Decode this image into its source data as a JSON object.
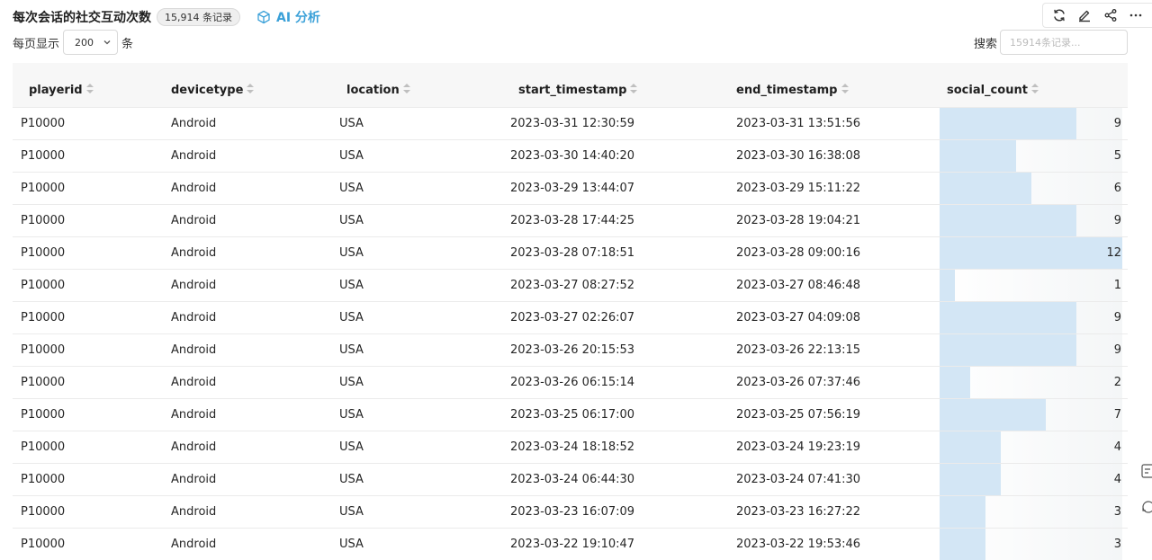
{
  "header": {
    "title": "每次会话的社交互动次数",
    "record_badge": "15,914 条记录",
    "ai_label": "AI 分析"
  },
  "toolbar": {
    "icons": [
      "refresh-icon",
      "edit-icon",
      "share-icon",
      "more-icon"
    ]
  },
  "pagination": {
    "prefix": "每页显示",
    "page_size": "200",
    "suffix": "条"
  },
  "search": {
    "label": "搜索",
    "placeholder": "15914条记录..."
  },
  "table": {
    "columns": [
      "playerid",
      "devicetype",
      "location",
      "start_timestamp",
      "end_timestamp",
      "social_count"
    ],
    "bar_max": 12,
    "bar_color": "#d3e6f5",
    "rows": [
      [
        "P10000",
        "Android",
        "USA",
        "2023-03-31 12:30:59",
        "2023-03-31 13:51:56",
        "9"
      ],
      [
        "P10000",
        "Android",
        "USA",
        "2023-03-30 14:40:20",
        "2023-03-30 16:38:08",
        "5"
      ],
      [
        "P10000",
        "Android",
        "USA",
        "2023-03-29 13:44:07",
        "2023-03-29 15:11:22",
        "6"
      ],
      [
        "P10000",
        "Android",
        "USA",
        "2023-03-28 17:44:25",
        "2023-03-28 19:04:21",
        "9"
      ],
      [
        "P10000",
        "Android",
        "USA",
        "2023-03-28 07:18:51",
        "2023-03-28 09:00:16",
        "12"
      ],
      [
        "P10000",
        "Android",
        "USA",
        "2023-03-27 08:27:52",
        "2023-03-27 08:46:48",
        "1"
      ],
      [
        "P10000",
        "Android",
        "USA",
        "2023-03-27 02:26:07",
        "2023-03-27 04:09:08",
        "9"
      ],
      [
        "P10000",
        "Android",
        "USA",
        "2023-03-26 20:15:53",
        "2023-03-26 22:13:15",
        "9"
      ],
      [
        "P10000",
        "Android",
        "USA",
        "2023-03-26 06:15:14",
        "2023-03-26 07:37:46",
        "2"
      ],
      [
        "P10000",
        "Android",
        "USA",
        "2023-03-25 06:17:00",
        "2023-03-25 07:56:19",
        "7"
      ],
      [
        "P10000",
        "Android",
        "USA",
        "2023-03-24 18:18:52",
        "2023-03-24 19:23:19",
        "4"
      ],
      [
        "P10000",
        "Android",
        "USA",
        "2023-03-24 06:44:30",
        "2023-03-24 07:41:30",
        "4"
      ],
      [
        "P10000",
        "Android",
        "USA",
        "2023-03-23 16:07:09",
        "2023-03-23 16:27:22",
        "3"
      ],
      [
        "P10000",
        "Android",
        "USA",
        "2023-03-22 19:10:47",
        "2023-03-22 19:53:46",
        "3"
      ]
    ]
  }
}
